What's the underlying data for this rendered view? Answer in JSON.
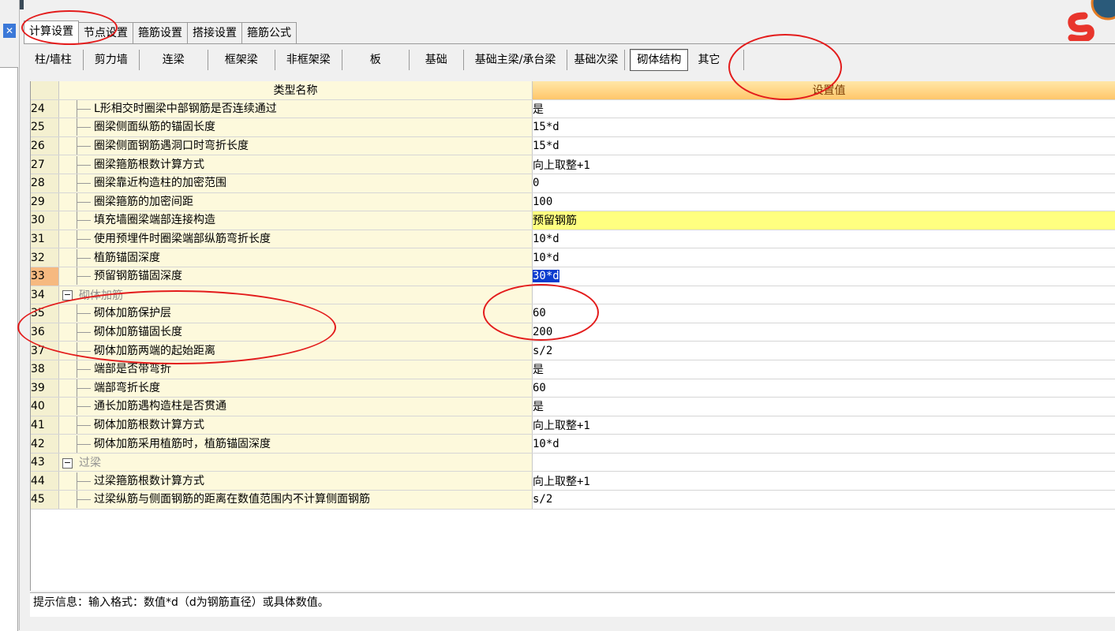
{
  "main_tabs": [
    "计算设置",
    "节点设置",
    "箍筋设置",
    "搭接设置",
    "箍筋公式"
  ],
  "sub_tabs": [
    "柱/墙柱",
    "剪力墙",
    "连梁",
    "框架梁",
    "非框架梁",
    "板",
    "基础",
    "基础主梁/承台梁",
    "基础次梁",
    "砌体结构",
    "其它"
  ],
  "grid": {
    "header_name": "类型名称",
    "header_value": "设置值",
    "rows": [
      {
        "num": "24",
        "name": "L形相交时圈梁中部钢筋是否连续通过",
        "value": "是"
      },
      {
        "num": "25",
        "name": "圈梁侧面纵筋的锚固长度",
        "value": "15*d"
      },
      {
        "num": "26",
        "name": "圈梁侧面钢筋遇洞口时弯折长度",
        "value": "15*d"
      },
      {
        "num": "27",
        "name": "圈梁箍筋根数计算方式",
        "value": "向上取整+1"
      },
      {
        "num": "28",
        "name": "圈梁靠近构造柱的加密范围",
        "value": "0"
      },
      {
        "num": "29",
        "name": "圈梁箍筋的加密间距",
        "value": "100"
      },
      {
        "num": "30",
        "name": "填充墙圈梁端部连接构造",
        "value": "预留钢筋"
      },
      {
        "num": "31",
        "name": "使用预埋件时圈梁端部纵筋弯折长度",
        "value": "10*d"
      },
      {
        "num": "32",
        "name": "植筋锚固深度",
        "value": "10*d"
      },
      {
        "num": "33",
        "name": "预留钢筋锚固深度",
        "value": "30*d"
      },
      {
        "num": "34",
        "name": "砌体加筋",
        "value": ""
      },
      {
        "num": "35",
        "name": "砌体加筋保护层",
        "value": "60"
      },
      {
        "num": "36",
        "name": "砌体加筋锚固长度",
        "value": "200"
      },
      {
        "num": "37",
        "name": "砌体加筋两端的起始距离",
        "value": "s/2"
      },
      {
        "num": "38",
        "name": "端部是否带弯折",
        "value": "是"
      },
      {
        "num": "39",
        "name": "端部弯折长度",
        "value": "60"
      },
      {
        "num": "40",
        "name": "通长加筋遇构造柱是否贯通",
        "value": "是"
      },
      {
        "num": "41",
        "name": "砌体加筋根数计算方式",
        "value": "向上取整+1"
      },
      {
        "num": "42",
        "name": "砌体加筋采用植筋时，植筋锚固深度",
        "value": "10*d"
      },
      {
        "num": "43",
        "name": "过梁",
        "value": ""
      },
      {
        "num": "44",
        "name": "过梁箍筋根数计算方式",
        "value": "向上取整+1"
      },
      {
        "num": "45",
        "name": "过梁纵筋与侧面钢筋的距离在数值范围内不计算侧面钢筋",
        "value": "s/2"
      }
    ]
  },
  "hint": "提示信息：输入格式：数值*d（d为钢筋直径）或具体数值。",
  "colors": {
    "accent": "#e31c1c",
    "selection": "#0a3ccf",
    "highlight": "#ffff80"
  }
}
